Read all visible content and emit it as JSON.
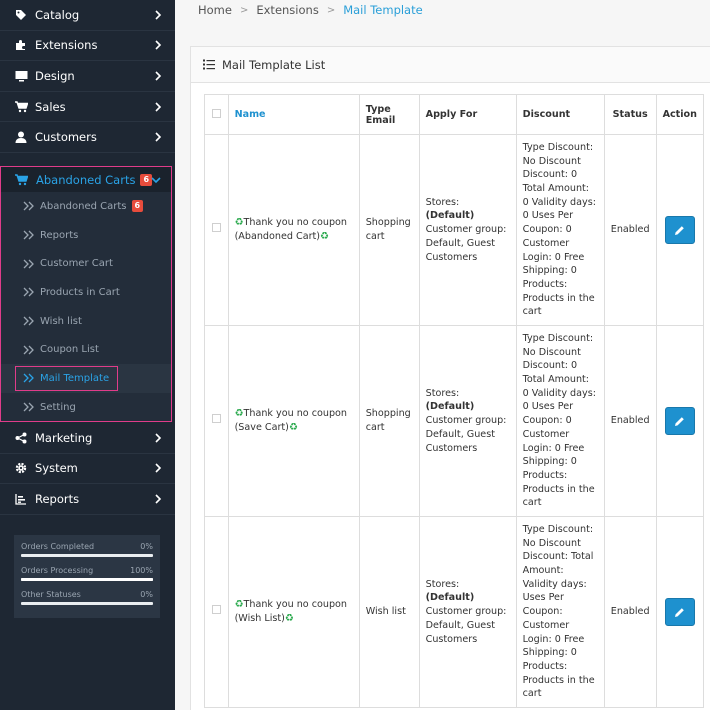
{
  "sidebar": {
    "items_top": [
      {
        "label": "Catalog",
        "icon": "tag-icon"
      },
      {
        "label": "Extensions",
        "icon": "puzzle-icon"
      },
      {
        "label": "Design",
        "icon": "monitor-icon"
      },
      {
        "label": "Sales",
        "icon": "cart-icon"
      },
      {
        "label": "Customers",
        "icon": "user-icon"
      }
    ],
    "abandoned": {
      "label": "Abandoned Carts",
      "badge": "6"
    },
    "submenu": [
      {
        "label": "Abandoned Carts",
        "badge": "6"
      },
      {
        "label": "Reports"
      },
      {
        "label": "Customer Cart"
      },
      {
        "label": "Products in Cart"
      },
      {
        "label": "Wish list"
      },
      {
        "label": "Coupon List"
      },
      {
        "label": "Mail Template"
      },
      {
        "label": "Setting"
      }
    ],
    "items_bottom": [
      {
        "label": "Marketing",
        "icon": "share-icon"
      },
      {
        "label": "System",
        "icon": "gear-icon"
      },
      {
        "label": "Reports",
        "icon": "bar-chart-icon"
      }
    ],
    "stats": [
      {
        "label": "Orders Completed",
        "value": "0%",
        "fraction": 0
      },
      {
        "label": "Orders Processing",
        "value": "100%",
        "fraction": 1
      },
      {
        "label": "Other Statuses",
        "value": "0%",
        "fraction": 0
      }
    ]
  },
  "breadcrumb": {
    "home": "Home",
    "ext": "Extensions",
    "current": "Mail Template"
  },
  "panel": {
    "title": "Mail Template List"
  },
  "table": {
    "headers": {
      "name": "Name",
      "type": "Type Email",
      "apply": "Apply For",
      "discount": "Discount",
      "status": "Status",
      "action": "Action"
    },
    "rows": [
      {
        "name": "Thank you no coupon (Abandoned Cart)",
        "type": "Shopping cart",
        "apply_stores_label": "Stores:",
        "apply_stores_value": "(Default)",
        "apply_rest": "Customer group: Default, Guest Customers",
        "discount": "Type Discount: No Discount Discount: 0 Total Amount: 0 Validity days: 0 Uses Per Coupon: 0 Customer Login: 0 Free Shipping: 0 Products: Products in the cart",
        "status": "Enabled"
      },
      {
        "name": "Thank you no coupon (Save Cart)",
        "type": "Shopping cart",
        "apply_stores_label": "Stores:",
        "apply_stores_value": "(Default)",
        "apply_rest": "Customer group: Default, Guest Customers",
        "discount": "Type Discount: No Discount Discount: 0 Total Amount: 0 Validity days: 0 Uses Per Coupon: 0 Customer Login: 0 Free Shipping: 0 Products: Products in the cart",
        "status": "Enabled"
      },
      {
        "name": "Thank you no coupon (Wish List)",
        "type": "Wish list",
        "apply_stores_label": "Stores:",
        "apply_stores_value": "(Default)",
        "apply_rest": "Customer group: Default, Guest Customers",
        "discount": "Type Discount: No Discount Discount: Total Amount: Validity days: Uses Per Coupon: Customer Login: 0 Free Shipping: 0 Products: Products in the cart",
        "status": "Enabled"
      }
    ]
  },
  "colors": {
    "accent": "#1e91cf",
    "sidebar": "#1e2733",
    "highlight": "#e03c8a",
    "badge": "#e74c3c"
  }
}
